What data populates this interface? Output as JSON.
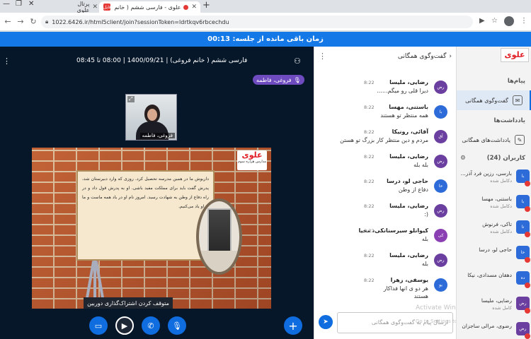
{
  "browser": {
    "tabs": [
      {
        "label": "پرتال علوی"
      },
      {
        "label": "علوی - فارسی ششم ( خانم فر...",
        "fav": "فایل"
      }
    ],
    "url": "1022.6426.ir/html5client/join?sessionToken=ldrtkqv6rbcechdu"
  },
  "session": {
    "timer_text": "زمان باقی مانده از جلسه: 00:13"
  },
  "stage": {
    "title": "فارسی ششم ( خانم فروغی) | 1400/09/21 | 08:00 تا 08:45",
    "presenter_chip": "فروغی، فاطمه",
    "webcam_name": "فروغی، فاطمه",
    "slide_logo_main": "علوی",
    "slide_logo_sub": "مدارس هزاره سوم",
    "slide_text": "داریوش ما در همین مدرسه تحصیل کرد. روزی که وارد دبیرستان شد، پدرش گفت باید برای مملکت مفید باشی. او به پدرش قول داد و در راه دفاع از وطن به شهادت رسید. امروز نام او در یاد همه ماست و ما از او یاد می‌کنیم.",
    "control_label": "متوقف کردن اشتراک‌گذاری دوربین"
  },
  "chat": {
    "title": "گفت‌وگوی همگانی",
    "input_placeholder": "ارسال پیام به گفت‌وگوی همگانی",
    "watermark_1": "Activate Windows",
    "watermark_2": "Go to Settings to activate Windows",
    "messages": [
      {
        "avatar": "رض",
        "color": "#6b3fa0",
        "name": "رضایی، ملیسا",
        "time": "8:22",
        "text": "دیرا قلی رو میگم......"
      },
      {
        "avatar": "با",
        "color": "#2d6bd8",
        "name": "باستنی، مهسا",
        "time": "8:22",
        "text": "همه منتظر تو هستند"
      },
      {
        "avatar": "آق",
        "color": "#6b3fa0",
        "name": "آقائی، رونیکا",
        "time": "8:22",
        "text": "مردم و دین منتظر کار بزرگ تو هستن"
      },
      {
        "avatar": "رض",
        "color": "#6b3fa0",
        "name": "رضایی، ملیسا",
        "time": "8:22",
        "text": "بله بله"
      },
      {
        "avatar": "حا",
        "color": "#2d6bd8",
        "name": "حاجی لو، درسا",
        "time": "8:22",
        "text": "دفاع از وطن"
      },
      {
        "avatar": "رض",
        "color": "#6b3fa0",
        "name": "رضایی، ملیسا",
        "time": "8:22",
        "text": "(:"
      },
      {
        "avatar": "کی",
        "color": "#8a3fb3",
        "name": "کیوانلو سیرسنانکی، محیا",
        "time": "8:22",
        "text": "بله"
      },
      {
        "avatar": "رض",
        "color": "#6b3fa0",
        "name": "رضایی، ملیسا",
        "time": "8:22",
        "text": "بله"
      },
      {
        "avatar": "یو",
        "color": "#2d6bd8",
        "name": "یوسفی، زهرا",
        "time": "8:22",
        "text": "هر دو ی انها فداکار"
      },
      {
        "avatar": "",
        "color": "transparent",
        "name": "",
        "time": "",
        "text": "هستند"
      }
    ]
  },
  "sidebar": {
    "brand": "علوی",
    "messages_heading": "پیام‌ها",
    "public_chat_label": "گفت‌وگوی همگانی",
    "notes_heading": "یادداشت‌ها",
    "shared_notes_label": "یادداشت‌های همگانی",
    "users_heading": "کاربران (24)",
    "users": [
      {
        "avatar": "با",
        "color": "#2d6bd8",
        "name": "بارسی، رزین فرد آذر...",
        "status": "دکامل شده"
      },
      {
        "avatar": "با",
        "color": "#2d6bd8",
        "name": "باستنی، مهسا",
        "status": "دکامل شده"
      },
      {
        "avatar": "تا",
        "color": "#2d6bd8",
        "name": "تاکی، فرنوش",
        "status": "دکامل شده"
      },
      {
        "avatar": "حا",
        "color": "#2d6bd8",
        "name": "حاجی لو، درسا",
        "status": ""
      },
      {
        "avatar": "ده",
        "color": "#2d6bd8",
        "name": "دهقان مسدادی، نیکا",
        "status": ""
      },
      {
        "avatar": "رض",
        "color": "#6b3fa0",
        "name": "رضایی، ملیسا",
        "status": "کامل شده"
      },
      {
        "avatar": "رض",
        "color": "#6b3fa0",
        "name": "رضوی، مرالی ساجزان",
        "status": ""
      }
    ]
  }
}
